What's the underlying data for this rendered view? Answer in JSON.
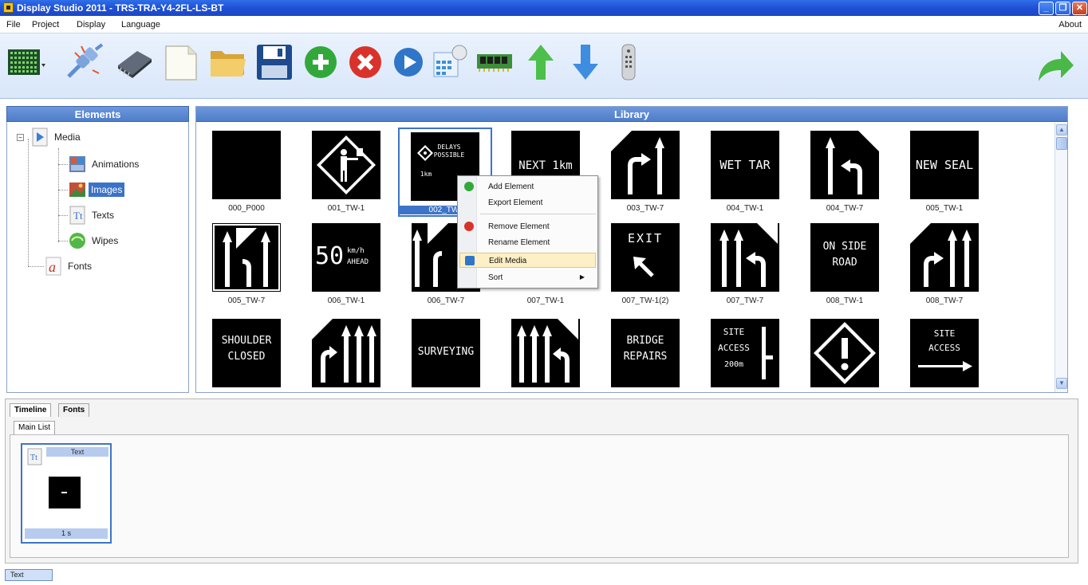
{
  "window": {
    "title": "Display Studio 2011 - TRS-TRA-Y4-2FL-LS-BT"
  },
  "menu": {
    "items": [
      "File",
      "Project",
      "Display",
      "Language"
    ],
    "about": "About"
  },
  "toolbar": {
    "buttons": [
      "sign-grid-icon",
      "disconnect-icon",
      "chip-icon",
      "new-file-icon",
      "open-folder-icon",
      "save-icon",
      "add-icon",
      "delete-icon",
      "play-icon",
      "calculator-icon",
      "memory-icon",
      "upload-icon",
      "download-icon",
      "remote-icon",
      "redo-arrow-icon"
    ]
  },
  "elements_panel": {
    "title": "Elements",
    "tree": {
      "media": "Media",
      "children": [
        "Animations",
        "Images",
        "Texts",
        "Wipes"
      ],
      "fonts": "Fonts",
      "selected": "Images"
    }
  },
  "library_panel": {
    "title": "Library",
    "items": [
      {
        "name": "000_P000",
        "sign": ""
      },
      {
        "name": "001_TW-1",
        "sign": "flagman"
      },
      {
        "name": "002_TW-",
        "sign": "DELAYS POSSIBLE 1km"
      },
      {
        "name": "",
        "sign": "NEXT 1km"
      },
      {
        "name": "003_TW-7",
        "sign": "lanes"
      },
      {
        "name": "004_TW-1",
        "sign": "WET TAR"
      },
      {
        "name": "004_TW-7",
        "sign": "lanes"
      },
      {
        "name": "005_TW-1",
        "sign": "NEW SEAL"
      },
      {
        "name": "005_TW-7",
        "sign": "lanes"
      },
      {
        "name": "006_TW-1",
        "sign": "50 km/h AHEAD"
      },
      {
        "name": "006_TW-7",
        "sign": "lanes"
      },
      {
        "name": "007_TW-1",
        "sign": ""
      },
      {
        "name": "007_TW-1(2)",
        "sign": "EXIT"
      },
      {
        "name": "007_TW-7",
        "sign": "lanes"
      },
      {
        "name": "008_TW-1",
        "sign": "ON SIDE ROAD"
      },
      {
        "name": "008_TW-7",
        "sign": "lanes"
      },
      {
        "name": "",
        "sign": "SHOULDER CLOSED"
      },
      {
        "name": "",
        "sign": "lanes"
      },
      {
        "name": "",
        "sign": "SURVEYING"
      },
      {
        "name": "",
        "sign": "lanes"
      },
      {
        "name": "",
        "sign": "BRIDGE REPAIRS"
      },
      {
        "name": "",
        "sign": "SITE ACCESS 200m"
      },
      {
        "name": "",
        "sign": "warning"
      },
      {
        "name": "",
        "sign": "SITE ACCESS"
      }
    ],
    "sign_text": {
      "delays_1": "DELAYS",
      "delays_2": "POSSIBLE",
      "delays_3": "1km",
      "next": "NEXT 1km",
      "wet_tar": "WET TAR",
      "new_seal": "NEW SEAL",
      "speed_num": "50",
      "speed_unit": "km/h",
      "speed_ahead": "AHEAD",
      "exit": "EXIT",
      "side_1": "ON SIDE",
      "side_2": "ROAD",
      "shoulder_1": "SHOULDER",
      "shoulder_2": "CLOSED",
      "surveying": "SURVEYING",
      "bridge_1": "BRIDGE",
      "bridge_2": "REPAIRS",
      "site_1": "SITE",
      "site_2": "ACCESS",
      "site_3": "200m",
      "site2_1": "SITE",
      "site2_2": "ACCESS"
    }
  },
  "context_menu": {
    "items": [
      "Add Element",
      "Export Element",
      "Remove Element",
      "Rename Element",
      "Edit Media",
      "Sort"
    ],
    "highlighted": "Edit Media"
  },
  "bottom": {
    "tabs": [
      "Timeline",
      "Fonts"
    ],
    "active_tab": "Timeline",
    "subtab": "Main List",
    "card": {
      "title": "Text",
      "duration": "1 s"
    }
  },
  "status": {
    "label": "Text"
  },
  "colors": {
    "accent": "#3d74c9",
    "titlebar": "#1e50d6",
    "panel_header": "#5a86cf",
    "menu_highlight": "#fdf0c6"
  }
}
